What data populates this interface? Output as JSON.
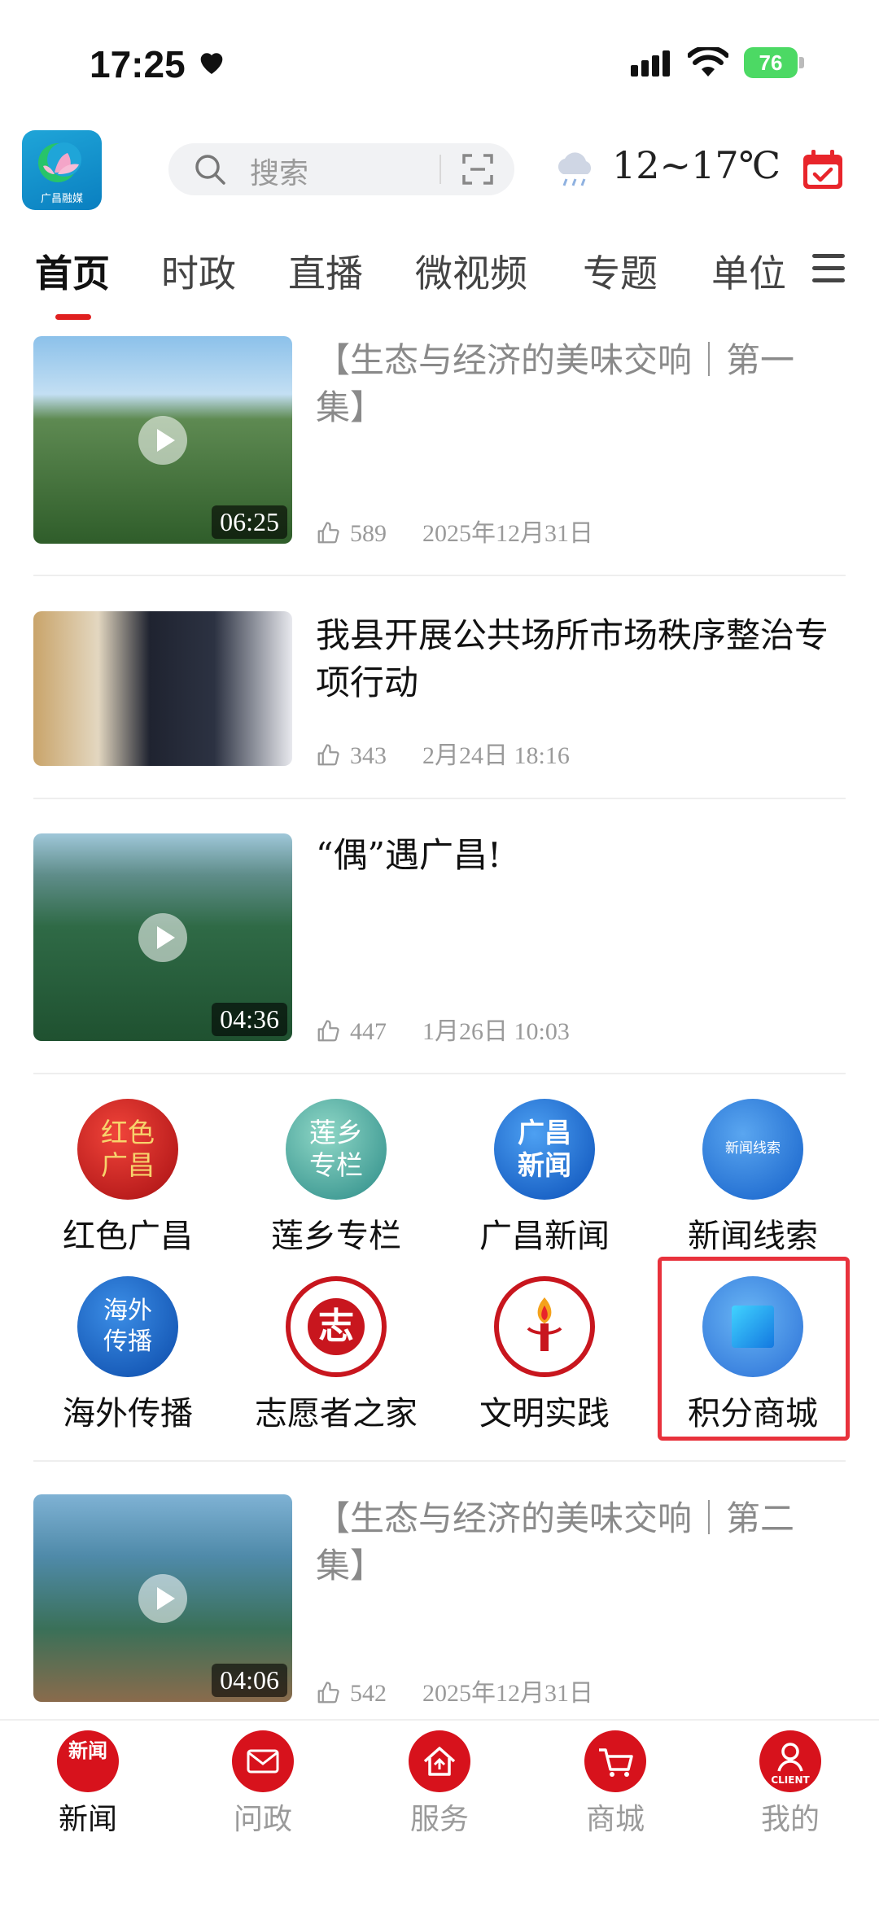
{
  "status_bar": {
    "time": "17:25",
    "battery": "76"
  },
  "header": {
    "logo_text": "广昌融媒",
    "search_placeholder": "搜索",
    "temperature": "12~17℃"
  },
  "tabs": [
    {
      "label": "首页",
      "active": true
    },
    {
      "label": "时政"
    },
    {
      "label": "直播"
    },
    {
      "label": "微视频"
    },
    {
      "label": "专题"
    },
    {
      "label": "单位"
    }
  ],
  "news": [
    {
      "title": "【生态与经济的美味交响｜第一集】",
      "likes": "589",
      "date": "2025年12月31日",
      "duration": "06:25",
      "video": true
    },
    {
      "title": "我县开展公共场所市场秩序整治专项行动",
      "likes": "343",
      "date": "2月24日  18:16",
      "video": false
    },
    {
      "title": "“偶”遇广昌!",
      "likes": "447",
      "date": "1月26日  10:03",
      "duration": "04:36",
      "video": true
    },
    {
      "title": "【生态与经济的美味交响｜第二集】",
      "likes": "542",
      "date": "2025年12月31日",
      "duration": "04:06",
      "video": true
    }
  ],
  "grid": [
    {
      "label": "红色广昌",
      "icon": "red-guangchang-icon",
      "icon_text": "红色广昌"
    },
    {
      "label": "莲乡专栏",
      "icon": "lotus-column-icon",
      "icon_text": "莲乡专栏"
    },
    {
      "label": "广昌新闻",
      "icon": "guangchang-news-icon",
      "icon_text": "广昌新闻"
    },
    {
      "label": "新闻线索",
      "icon": "news-tips-icon",
      "icon_text": "新闻线索"
    },
    {
      "label": "海外传播",
      "icon": "overseas-icon",
      "icon_text": "海外传播"
    },
    {
      "label": "志愿者之家",
      "icon": "volunteer-icon",
      "icon_text": "志"
    },
    {
      "label": "文明实践",
      "icon": "civilization-icon",
      "icon_text": ""
    },
    {
      "label": "积分商城",
      "icon": "points-mall-icon",
      "icon_text": ""
    }
  ],
  "bottom_nav": [
    {
      "label": "新闻",
      "icon": "news-icon",
      "icon_text": "新闻",
      "active": true
    },
    {
      "label": "问政",
      "icon": "mail-icon"
    },
    {
      "label": "服务",
      "icon": "service-icon"
    },
    {
      "label": "商城",
      "icon": "cart-icon"
    },
    {
      "label": "我的",
      "icon": "user-icon",
      "icon_text": "CLIENT"
    }
  ],
  "colors": {
    "accent": "#e02020",
    "highlight": "#e8323c"
  }
}
